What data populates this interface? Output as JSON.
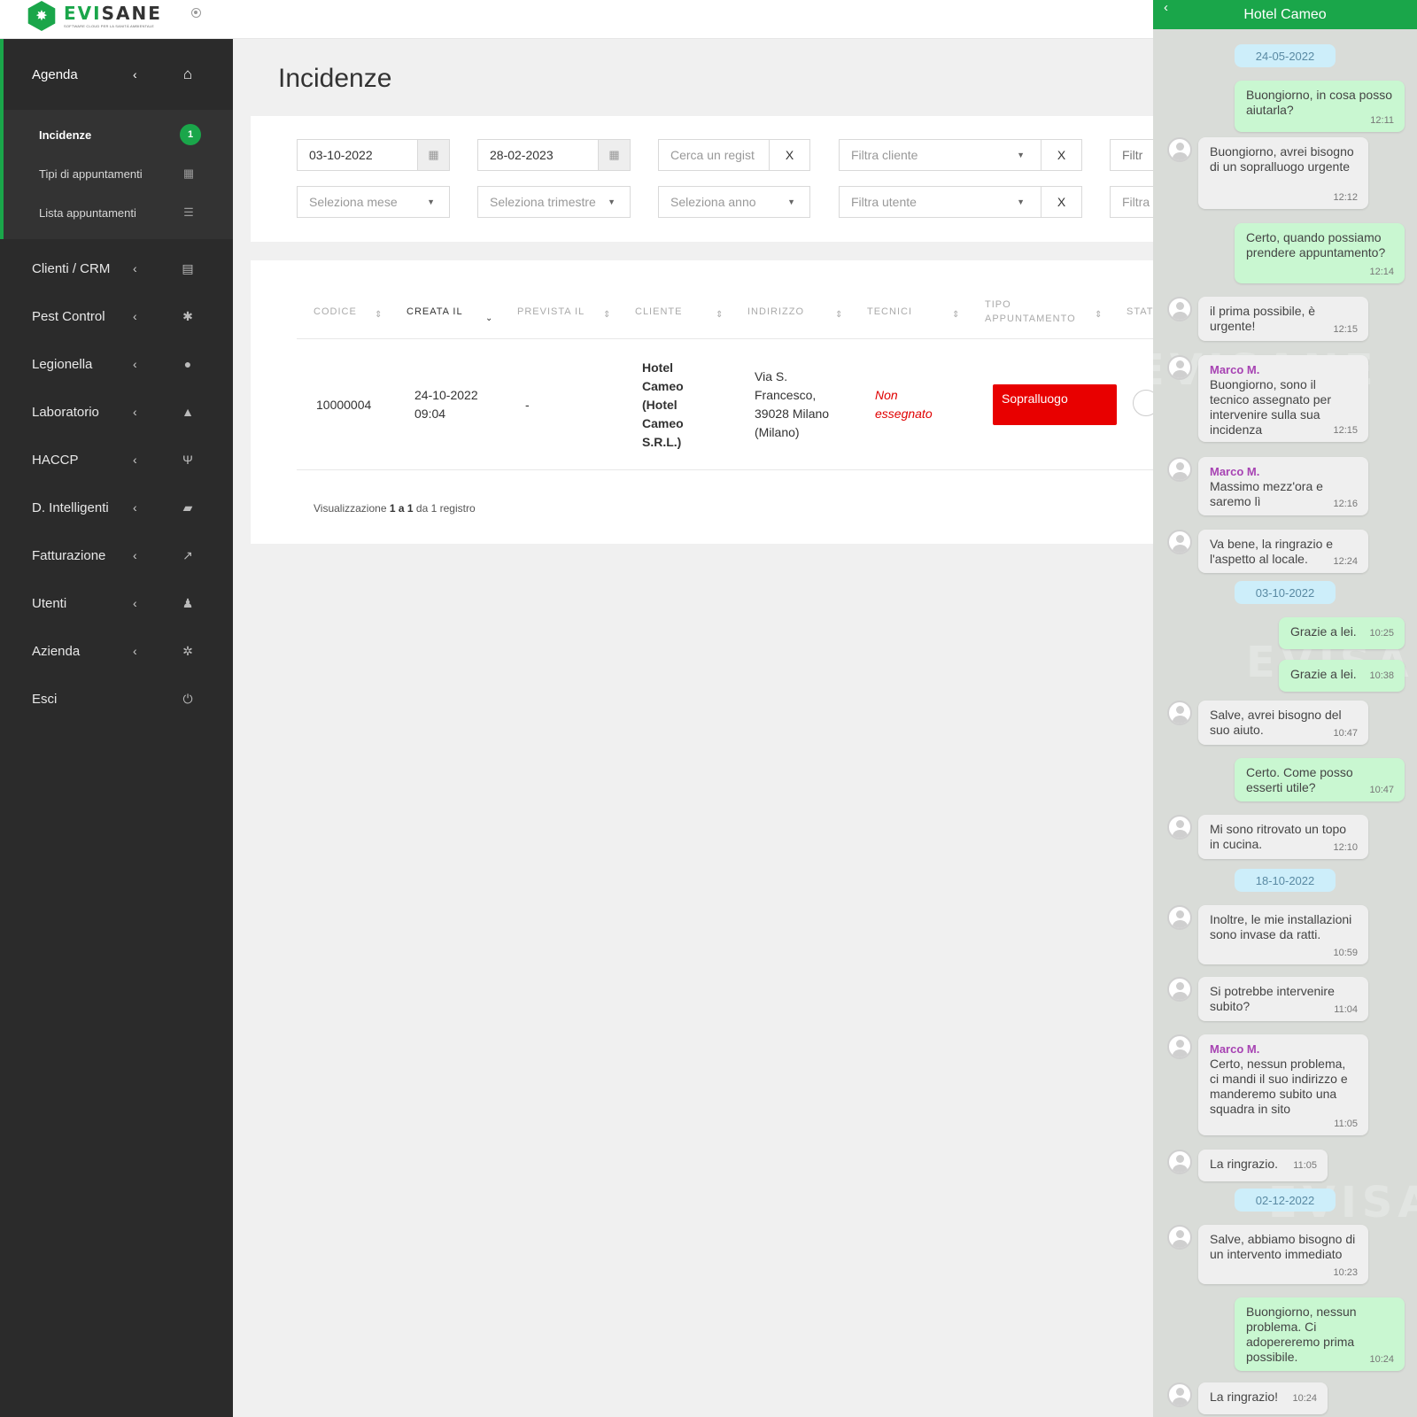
{
  "header": {
    "logo_word_green": "EVI",
    "logo_word_dark": "SANE",
    "logo_tagline": "SOFTWARE CLOUD PER LA SANITÀ AMBIENTALE"
  },
  "sidebar": {
    "agenda": {
      "label": "Agenda",
      "icon": "home-icon"
    },
    "submenu": [
      {
        "label": "Incidenze",
        "badge": "1"
      },
      {
        "label": "Tipi di appuntamenti",
        "icon": "calendar-icon"
      },
      {
        "label": "Lista appuntamenti",
        "icon": "list-icon"
      }
    ],
    "items": [
      {
        "label": "Clienti / CRM",
        "icon": "id-card-icon"
      },
      {
        "label": "Pest Control",
        "icon": "bug-icon"
      },
      {
        "label": "Legionella",
        "icon": "drop-icon"
      },
      {
        "label": "Laboratorio",
        "icon": "flask-icon"
      },
      {
        "label": "HACCP",
        "icon": "cutlery-icon"
      },
      {
        "label": "D. Intelligenti",
        "icon": "folder-open-icon"
      },
      {
        "label": "Fatturazione",
        "icon": "chart-line-icon"
      },
      {
        "label": "Utenti",
        "icon": "user-icon"
      },
      {
        "label": "Azienda",
        "icon": "gear-icon"
      }
    ],
    "logout": {
      "label": "Esci",
      "icon": "power-icon"
    }
  },
  "page": {
    "title": "Incidenze"
  },
  "filters": {
    "date_from": "03-10-2022",
    "date_to": "28-02-2023",
    "search_placeholder": "Cerca un regist",
    "client_placeholder": "Filtra cliente",
    "extra1_placeholder": "Filtr",
    "month_placeholder": "Seleziona mese",
    "quarter_placeholder": "Seleziona trimestre",
    "year_placeholder": "Seleziona anno",
    "user_placeholder": "Filtra utente",
    "extra2_placeholder": "Filtra",
    "clear_label": "X"
  },
  "table": {
    "headers": {
      "codice": "CODICE",
      "creata_il": "CREATA IL",
      "prevista_il": "PREVISTA IL",
      "cliente": "CLIENTE",
      "indirizzo": "INDIRIZZO",
      "tecnici": "TECNICI",
      "tipo_1": "TIPO",
      "tipo_2": "APPUNTAMENTO",
      "stato": "STAT"
    },
    "row": {
      "codice": "10000004",
      "creata_1": "24-10-2022",
      "creata_2": "09:04",
      "prevista": "-",
      "cliente": [
        "Hotel",
        "Cameo",
        "(Hotel",
        "Cameo",
        "S.R.L.)"
      ],
      "indirizzo": [
        "Via S.",
        "Francesco,",
        "39028 Milano",
        "(Milano)"
      ],
      "tecnici": [
        "Non",
        "essegnato"
      ],
      "tipo": "Sopralluogo"
    },
    "footer": {
      "prefix": "Visualizzazione",
      "range": "1 a 1",
      "mid": "da",
      "total": "1",
      "suffix": "registro"
    }
  },
  "chat": {
    "title": "Hotel Cameo",
    "watermark": "EVISANE",
    "dates": [
      "24-05-2022",
      "03-10-2022",
      "18-10-2022",
      "02-12-2022"
    ],
    "messages": [
      {
        "text": "Buongiorno, in cosa posso aiutarla?",
        "time": "12:11"
      },
      {
        "text": "Buongiorno, avrei bisogno di un sopralluogo urgente",
        "time": "12:12"
      },
      {
        "text": "Certo, quando possiamo prendere appuntamento?",
        "time": "12:14"
      },
      {
        "text": "il prima possibile, è urgente!",
        "time": "12:15"
      },
      {
        "sender": "Marco M.",
        "text": "Buongiorno, sono il tecnico assegnato per intervenire sulla sua incidenza",
        "time": "12:15"
      },
      {
        "sender": "Marco M.",
        "text": "Massimo mezz'ora e saremo lì",
        "time": "12:16"
      },
      {
        "text": "Va bene, la ringrazio e l'aspetto al locale.",
        "time": "12:24"
      },
      {
        "text": "Grazie a lei.",
        "time": "10:25"
      },
      {
        "text": "Grazie a lei.",
        "time": "10:38"
      },
      {
        "text": "Salve, avrei bisogno del suo aiuto.",
        "time": "10:47"
      },
      {
        "text": "Certo. Come posso esserti utile?",
        "time": "10:47"
      },
      {
        "text": "Mi sono ritrovato un topo in cucina.",
        "time": "12:10"
      },
      {
        "text": "Inoltre, le mie installazioni sono invase da ratti.",
        "time": "10:59"
      },
      {
        "text": "Si potrebbe intervenire subito?",
        "time": "11:04"
      },
      {
        "sender": "Marco M.",
        "text": "Certo, nessun problema, ci mandi il suo indirizzo e manderemo subito una squadra in sito",
        "time": "11:05"
      },
      {
        "text": "La ringrazio.",
        "time": "11:05"
      },
      {
        "text": "Salve, abbiamo bisogno di un intervento immediato",
        "time": "10:23"
      },
      {
        "text": "Buongiorno, nessun problema. Ci adopereremo prima possibile.",
        "time": "10:24"
      },
      {
        "text": "La ringrazio!",
        "time": "10:24"
      }
    ]
  },
  "colors": {
    "brand_green": "#1aa64a",
    "sidebar_bg": "#2b2b2b",
    "alert_red": "#e80000",
    "outgoing_bubble": "#c9f7d1",
    "incoming_bubble": "#efefef",
    "date_pill": "#cdeefa",
    "sender_name": "#a743b3"
  }
}
